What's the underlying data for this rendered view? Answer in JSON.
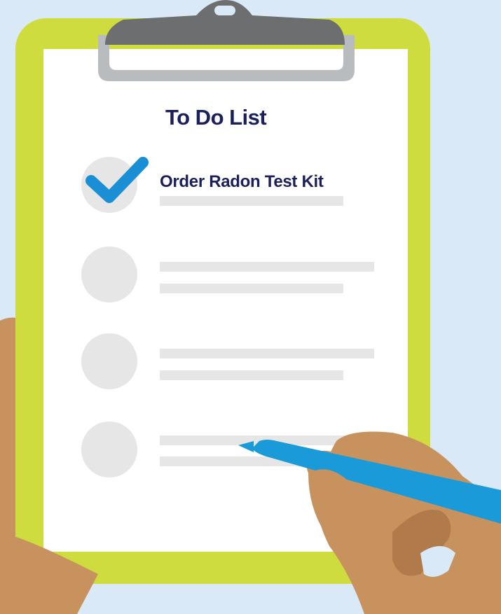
{
  "title": "To Do List",
  "items": [
    {
      "label": "Order Radon Test Kit",
      "checked": true
    },
    {
      "label": "",
      "checked": false
    },
    {
      "label": "",
      "checked": false
    },
    {
      "label": "",
      "checked": false
    }
  ],
  "icons": {
    "check": "checkmark-icon",
    "pen": "pen-icon",
    "clip": "clipboard-clip-icon"
  },
  "colors": {
    "background": "#d9e9f7",
    "board": "#cfdc3e",
    "paper": "#ffffff",
    "clip": "#6d6e70",
    "clip_frame": "#b9bcbf",
    "title_text": "#1b1f5c",
    "checkmark": "#1a8fd6",
    "circle": "#e6e6e6",
    "line": "#e6e6e6",
    "skin": "#c8925e",
    "skin_shade": "#b07a4a",
    "pen": "#1a9ad9"
  }
}
